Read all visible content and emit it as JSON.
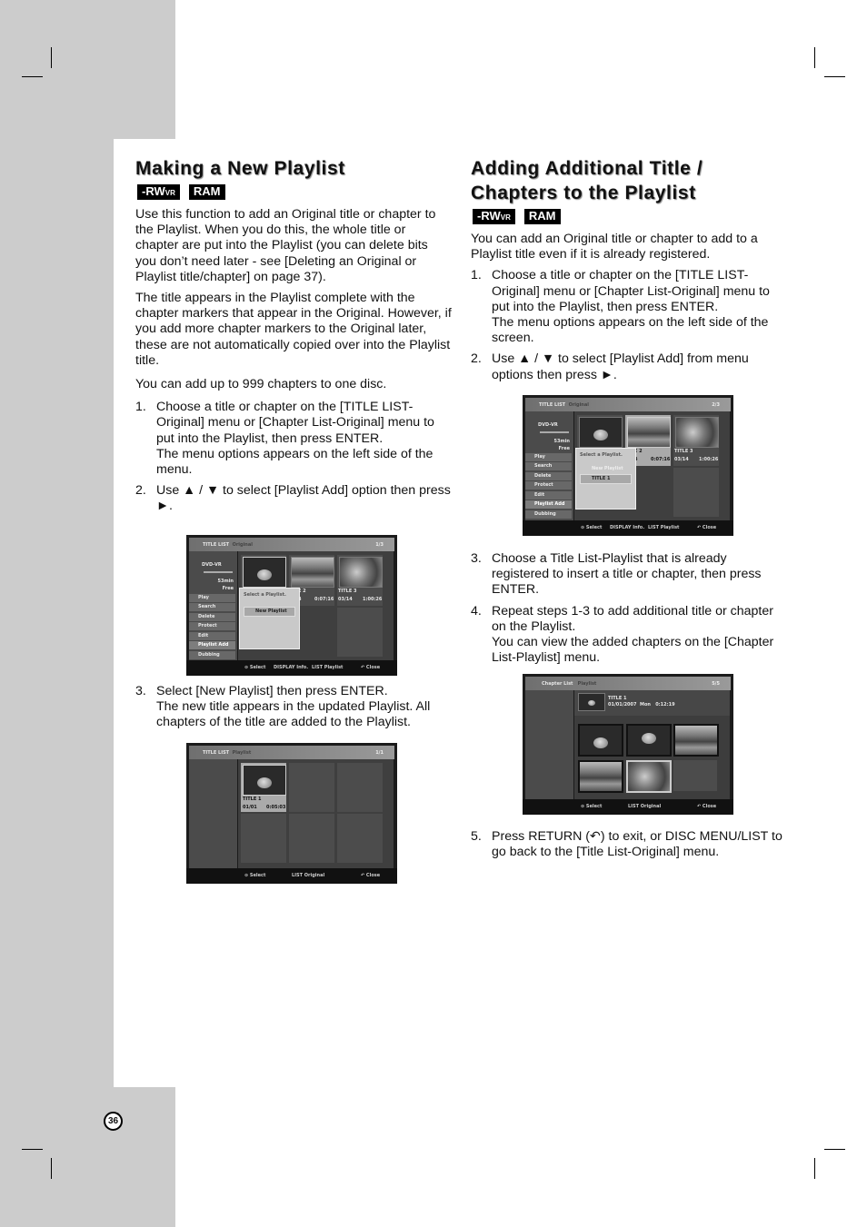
{
  "page_number": "36",
  "left": {
    "title": "Making a New Playlist",
    "badges": {
      "rw": "-RW",
      "rw_sub": "VR",
      "ram": "RAM"
    },
    "paragraphs": [
      "Use this function to add an Original title or chapter to the Playlist. When you do this, the whole title or chapter are put into the Playlist (you can delete bits you don’t need later - see [Deleting an Original or Playlist title/chapter] on page 37).",
      "The title appears in the Playlist complete with the chapter markers that appear in the Original. However, if you add more chapter markers to the Original later, these are not automatically copied over into the Playlist title.",
      "You can add up to 999 chapters to one disc."
    ],
    "steps": [
      {
        "num": "1.",
        "text": "Choose a title or chapter on the [TITLE LIST-Original] menu or [Chapter List-Original] menu to put into the Playlist, then press ENTER.",
        "note": "The menu options appears on the left side of the menu."
      },
      {
        "num": "2.",
        "text": "Use ▲ / ▼ to select [Playlist Add] option then press ►."
      },
      {
        "num": "3.",
        "text": "Select [New Playlist] then press ENTER.",
        "note": "The new title appears in the updated Playlist. All chapters of the title are added to the Playlist."
      }
    ]
  },
  "right": {
    "title_line1": "Adding Additional Title /",
    "title_line2": "Chapters to the Playlist",
    "badges": {
      "rw": "-RW",
      "rw_sub": "VR",
      "ram": "RAM"
    },
    "intro": "You can add an Original title or chapter to add to a Playlist title even if it is already registered.",
    "steps": [
      {
        "num": "1.",
        "text": "Choose a title or chapter on the [TITLE LIST-Original] menu or [Chapter List-Original] menu to put into the Playlist, then press ENTER.",
        "note": "The menu options appears on the left side of the screen."
      },
      {
        "num": "2.",
        "text": "Use ▲ / ▼ to select [Playlist Add] from menu options then press ►."
      },
      {
        "num": "3.",
        "text": "Choose a Title List-Playlist that is already registered to insert a title or chapter, then press ENTER."
      },
      {
        "num": "4.",
        "text": "Repeat steps 1-3 to add additional title or chapter on the Playlist.",
        "note": "You can view the added chapters on the [Chapter List-Playlist] menu."
      },
      {
        "num": "5.",
        "text": "Press RETURN (↶) to exit, or DISC MENU/LIST to go back to the [Title List-Original] menu."
      }
    ]
  },
  "screens": {
    "s1": {
      "header": "TITLE LIST",
      "sub": "Original",
      "page": "1/3",
      "disc": "DVD-VR",
      "free_time": "53min",
      "free": "Free",
      "menu": [
        "Play",
        "Search",
        "Delete",
        "Protect",
        "Edit",
        "Playlist Add",
        "Dubbing"
      ],
      "popup_title": "Select a Playlist.",
      "popup_items": [
        "New Playlist"
      ],
      "t2": "E 2",
      "t2_date": "4",
      "t2_time": "0:07:16",
      "t3": "TITLE 3",
      "t3_date": "03/14",
      "t3_time": "1:00:26",
      "footer": [
        "⊙ Select",
        "DISPLAY Info.",
        "LIST Playlist",
        "↶ Close"
      ]
    },
    "s2": {
      "header": "TITLE LIST",
      "sub": "Playlist",
      "page": "1/1",
      "t1": "TITLE 1",
      "t1_date": "01/01",
      "t1_time": "0:05:03",
      "footer": [
        "⊙ Select",
        "LIST Original",
        "↶ Close"
      ]
    },
    "s3": {
      "header": "TITLE LIST",
      "sub": "Original",
      "page": "2/3",
      "disc": "DVD-VR",
      "free_time": "53min",
      "free": "Free",
      "menu": [
        "Play",
        "Search",
        "Delete",
        "Protect",
        "Edit",
        "Playlist Add",
        "Dubbing"
      ],
      "popup_title": "Select a Playlist.",
      "popup_items": [
        "New Playlist",
        "TITLE 1"
      ],
      "t2": "E 2",
      "t2_date": "4",
      "t2_time": "0:07:16",
      "t3": "TITLE 3",
      "t3_date": "03/14",
      "t3_time": "1:00:26",
      "footer": [
        "⊙ Select",
        "DISPLAY Info.",
        "LIST Playlist",
        "↶ Close"
      ]
    },
    "s4": {
      "header": "Chapter List",
      "sub": "Playlist",
      "page": "5/5",
      "title": "TITLE 1",
      "date": "01/01/2007",
      "day": "Mon",
      "time": "0:12:19",
      "footer": [
        "⊙ Select",
        "LIST Original",
        "↶ Close"
      ]
    }
  }
}
